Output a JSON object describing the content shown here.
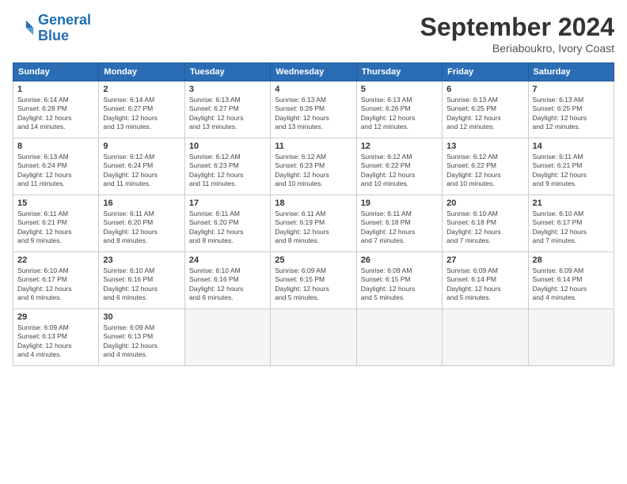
{
  "logo": {
    "line1": "General",
    "line2": "Blue"
  },
  "title": "September 2024",
  "location": "Beriaboukro, Ivory Coast",
  "header_days": [
    "Sunday",
    "Monday",
    "Tuesday",
    "Wednesday",
    "Thursday",
    "Friday",
    "Saturday"
  ],
  "weeks": [
    [
      {
        "day": "1",
        "info": "Sunrise: 6:14 AM\nSunset: 6:28 PM\nDaylight: 12 hours\nand 14 minutes."
      },
      {
        "day": "2",
        "info": "Sunrise: 6:14 AM\nSunset: 6:27 PM\nDaylight: 12 hours\nand 13 minutes."
      },
      {
        "day": "3",
        "info": "Sunrise: 6:13 AM\nSunset: 6:27 PM\nDaylight: 12 hours\nand 13 minutes."
      },
      {
        "day": "4",
        "info": "Sunrise: 6:13 AM\nSunset: 6:26 PM\nDaylight: 12 hours\nand 13 minutes."
      },
      {
        "day": "5",
        "info": "Sunrise: 6:13 AM\nSunset: 6:26 PM\nDaylight: 12 hours\nand 12 minutes."
      },
      {
        "day": "6",
        "info": "Sunrise: 6:13 AM\nSunset: 6:25 PM\nDaylight: 12 hours\nand 12 minutes."
      },
      {
        "day": "7",
        "info": "Sunrise: 6:13 AM\nSunset: 6:25 PM\nDaylight: 12 hours\nand 12 minutes."
      }
    ],
    [
      {
        "day": "8",
        "info": "Sunrise: 6:13 AM\nSunset: 6:24 PM\nDaylight: 12 hours\nand 11 minutes."
      },
      {
        "day": "9",
        "info": "Sunrise: 6:12 AM\nSunset: 6:24 PM\nDaylight: 12 hours\nand 11 minutes."
      },
      {
        "day": "10",
        "info": "Sunrise: 6:12 AM\nSunset: 6:23 PM\nDaylight: 12 hours\nand 11 minutes."
      },
      {
        "day": "11",
        "info": "Sunrise: 6:12 AM\nSunset: 6:23 PM\nDaylight: 12 hours\nand 10 minutes."
      },
      {
        "day": "12",
        "info": "Sunrise: 6:12 AM\nSunset: 6:22 PM\nDaylight: 12 hours\nand 10 minutes."
      },
      {
        "day": "13",
        "info": "Sunrise: 6:12 AM\nSunset: 6:22 PM\nDaylight: 12 hours\nand 10 minutes."
      },
      {
        "day": "14",
        "info": "Sunrise: 6:11 AM\nSunset: 6:21 PM\nDaylight: 12 hours\nand 9 minutes."
      }
    ],
    [
      {
        "day": "15",
        "info": "Sunrise: 6:11 AM\nSunset: 6:21 PM\nDaylight: 12 hours\nand 9 minutes."
      },
      {
        "day": "16",
        "info": "Sunrise: 6:11 AM\nSunset: 6:20 PM\nDaylight: 12 hours\nand 8 minutes."
      },
      {
        "day": "17",
        "info": "Sunrise: 6:11 AM\nSunset: 6:20 PM\nDaylight: 12 hours\nand 8 minutes."
      },
      {
        "day": "18",
        "info": "Sunrise: 6:11 AM\nSunset: 6:19 PM\nDaylight: 12 hours\nand 8 minutes."
      },
      {
        "day": "19",
        "info": "Sunrise: 6:11 AM\nSunset: 6:18 PM\nDaylight: 12 hours\nand 7 minutes."
      },
      {
        "day": "20",
        "info": "Sunrise: 6:10 AM\nSunset: 6:18 PM\nDaylight: 12 hours\nand 7 minutes."
      },
      {
        "day": "21",
        "info": "Sunrise: 6:10 AM\nSunset: 6:17 PM\nDaylight: 12 hours\nand 7 minutes."
      }
    ],
    [
      {
        "day": "22",
        "info": "Sunrise: 6:10 AM\nSunset: 6:17 PM\nDaylight: 12 hours\nand 6 minutes."
      },
      {
        "day": "23",
        "info": "Sunrise: 6:10 AM\nSunset: 6:16 PM\nDaylight: 12 hours\nand 6 minutes."
      },
      {
        "day": "24",
        "info": "Sunrise: 6:10 AM\nSunset: 6:16 PM\nDaylight: 12 hours\nand 6 minutes."
      },
      {
        "day": "25",
        "info": "Sunrise: 6:09 AM\nSunset: 6:15 PM\nDaylight: 12 hours\nand 5 minutes."
      },
      {
        "day": "26",
        "info": "Sunrise: 6:09 AM\nSunset: 6:15 PM\nDaylight: 12 hours\nand 5 minutes."
      },
      {
        "day": "27",
        "info": "Sunrise: 6:09 AM\nSunset: 6:14 PM\nDaylight: 12 hours\nand 5 minutes."
      },
      {
        "day": "28",
        "info": "Sunrise: 6:09 AM\nSunset: 6:14 PM\nDaylight: 12 hours\nand 4 minutes."
      }
    ],
    [
      {
        "day": "29",
        "info": "Sunrise: 6:09 AM\nSunset: 6:13 PM\nDaylight: 12 hours\nand 4 minutes."
      },
      {
        "day": "30",
        "info": "Sunrise: 6:09 AM\nSunset: 6:13 PM\nDaylight: 12 hours\nand 4 minutes."
      },
      {
        "day": "",
        "info": ""
      },
      {
        "day": "",
        "info": ""
      },
      {
        "day": "",
        "info": ""
      },
      {
        "day": "",
        "info": ""
      },
      {
        "day": "",
        "info": ""
      }
    ]
  ]
}
